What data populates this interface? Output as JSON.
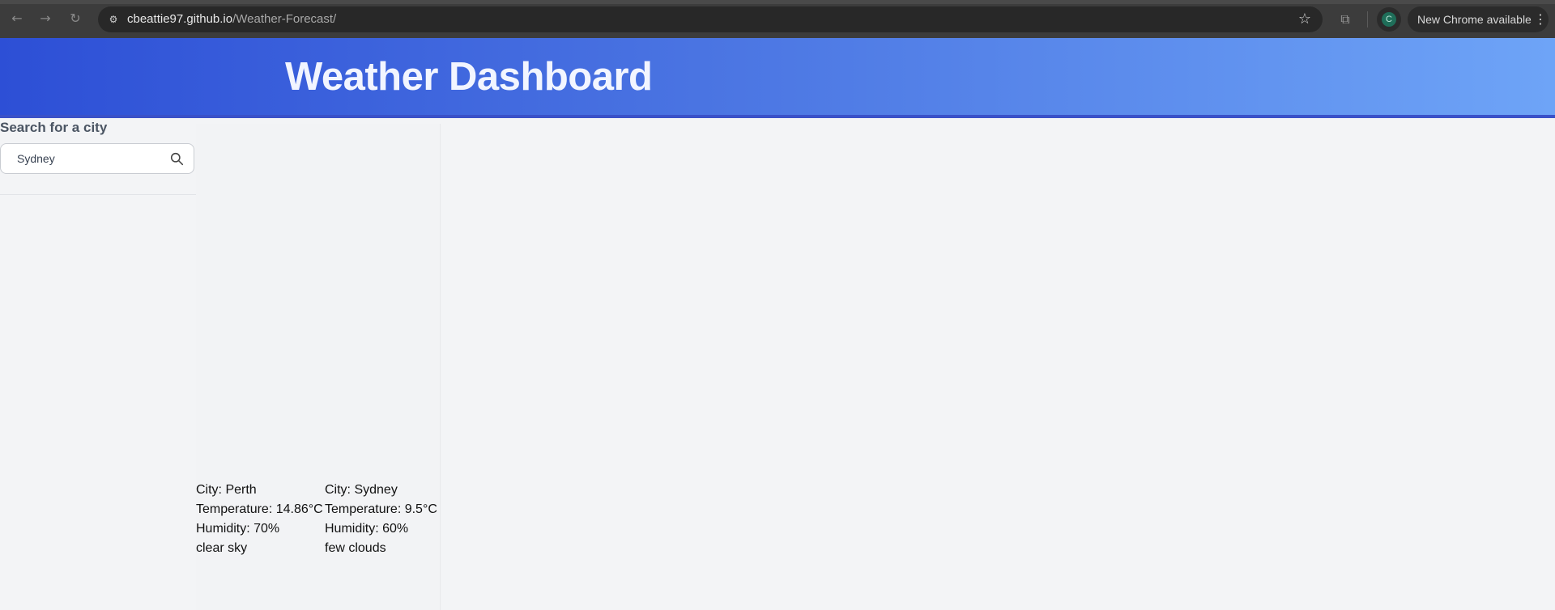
{
  "browser": {
    "back_icon": "arrow-left-icon",
    "forward_icon": "arrow-right-icon",
    "reload_icon": "reload-icon",
    "url_host": "cbeattie97.github.io",
    "url_path": "/Weather-Forecast/",
    "profile_initial": "C",
    "update_label": "New Chrome available"
  },
  "header": {
    "title": "Weather Dashboard"
  },
  "sidebar": {
    "search_label": "Search for a city",
    "search_value": "Sydney"
  },
  "results": [
    {
      "city": "City: Perth",
      "temperature": "Temperature: 14.86°C",
      "humidity": "Humidity: 70%",
      "description": "clear sky"
    },
    {
      "city": "City: Sydney",
      "temperature": "Temperature: 9.5°C",
      "humidity": "Humidity: 60%",
      "description": "few clouds"
    }
  ],
  "colors": {
    "header_gradient_start": "#2d4fd6",
    "header_gradient_end": "#6ea4f7",
    "page_background": "#f3f4f6"
  }
}
